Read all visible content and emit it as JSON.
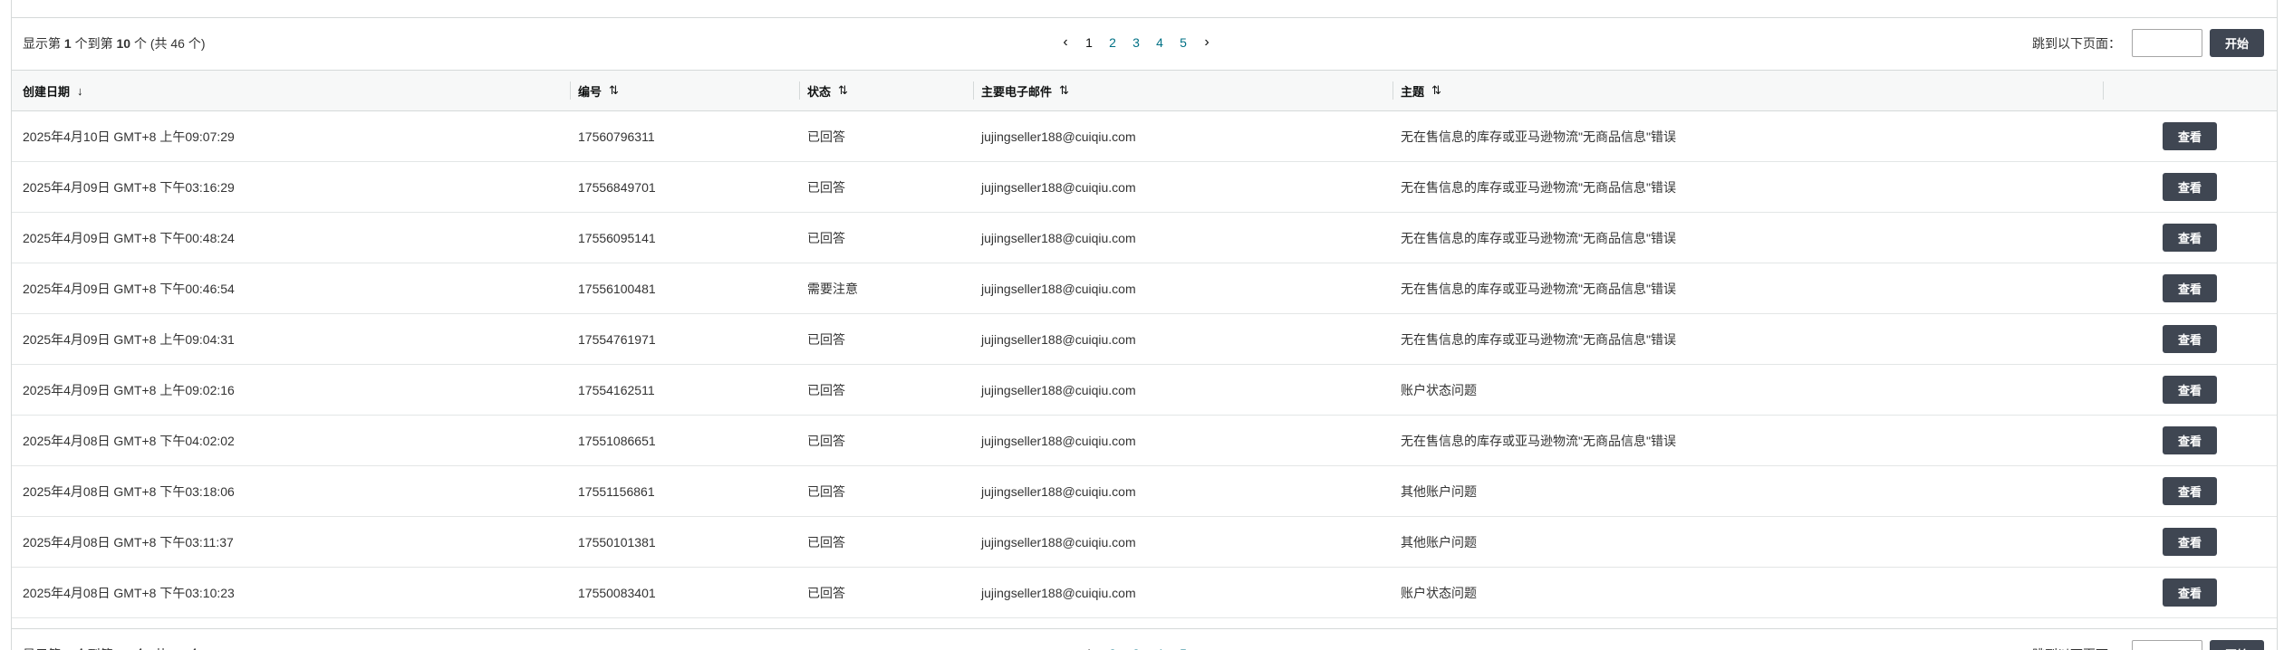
{
  "pagination": {
    "summary_prefix": "显示第",
    "range_start": "1",
    "summary_middle": "个到第",
    "range_end": "10",
    "summary_suffix": "个",
    "total_text": "(共 46 个)",
    "pages": [
      "1",
      "2",
      "3",
      "4",
      "5"
    ],
    "current_page": "1",
    "prev_symbol": "‹",
    "next_symbol": "›",
    "jump_label": "跳到以下页面：",
    "jump_value": "",
    "go_button": "开始"
  },
  "table": {
    "columns": [
      {
        "label": "创建日期",
        "sort_icon": "arrow-down-icon",
        "sort_glyph": "↓"
      },
      {
        "label": "编号",
        "sort_icon": "sort-updown-icon",
        "sort_glyph": "⇅"
      },
      {
        "label": "状态",
        "sort_icon": "sort-updown-icon",
        "sort_glyph": "⇅"
      },
      {
        "label": "主要电子邮件",
        "sort_icon": "sort-updown-icon",
        "sort_glyph": "⇅"
      },
      {
        "label": "主题",
        "sort_icon": "sort-updown-icon",
        "sort_glyph": "⇅"
      }
    ],
    "view_button": "查看",
    "rows": [
      {
        "date": "2025年4月10日 GMT+8 上午09:07:29",
        "id": "17560796311",
        "status": "已回答",
        "email": "jujingseller188@cuiqiu.com",
        "subject": "无在售信息的库存或亚马逊物流\"无商品信息\"错误"
      },
      {
        "date": "2025年4月09日 GMT+8 下午03:16:29",
        "id": "17556849701",
        "status": "已回答",
        "email": "jujingseller188@cuiqiu.com",
        "subject": "无在售信息的库存或亚马逊物流\"无商品信息\"错误"
      },
      {
        "date": "2025年4月09日 GMT+8 下午00:48:24",
        "id": "17556095141",
        "status": "已回答",
        "email": "jujingseller188@cuiqiu.com",
        "subject": "无在售信息的库存或亚马逊物流\"无商品信息\"错误"
      },
      {
        "date": "2025年4月09日 GMT+8 下午00:46:54",
        "id": "17556100481",
        "status": "需要注意",
        "email": "jujingseller188@cuiqiu.com",
        "subject": "无在售信息的库存或亚马逊物流\"无商品信息\"错误"
      },
      {
        "date": "2025年4月09日 GMT+8 上午09:04:31",
        "id": "17554761971",
        "status": "已回答",
        "email": "jujingseller188@cuiqiu.com",
        "subject": "无在售信息的库存或亚马逊物流\"无商品信息\"错误"
      },
      {
        "date": "2025年4月09日 GMT+8 上午09:02:16",
        "id": "17554162511",
        "status": "已回答",
        "email": "jujingseller188@cuiqiu.com",
        "subject": "账户状态问题"
      },
      {
        "date": "2025年4月08日 GMT+8 下午04:02:02",
        "id": "17551086651",
        "status": "已回答",
        "email": "jujingseller188@cuiqiu.com",
        "subject": "无在售信息的库存或亚马逊物流\"无商品信息\"错误"
      },
      {
        "date": "2025年4月08日 GMT+8 下午03:18:06",
        "id": "17551156861",
        "status": "已回答",
        "email": "jujingseller188@cuiqiu.com",
        "subject": "其他账户问题"
      },
      {
        "date": "2025年4月08日 GMT+8 下午03:11:37",
        "id": "17550101381",
        "status": "已回答",
        "email": "jujingseller188@cuiqiu.com",
        "subject": "其他账户问题"
      },
      {
        "date": "2025年4月08日 GMT+8 下午03:10:23",
        "id": "17550083401",
        "status": "已回答",
        "email": "jujingseller188@cuiqiu.com",
        "subject": "账户状态问题"
      }
    ]
  },
  "colors": {
    "button_bg": "#3f4652",
    "link": "#007185",
    "header_bg": "#f7f8f8",
    "border": "#d5d9d9"
  }
}
